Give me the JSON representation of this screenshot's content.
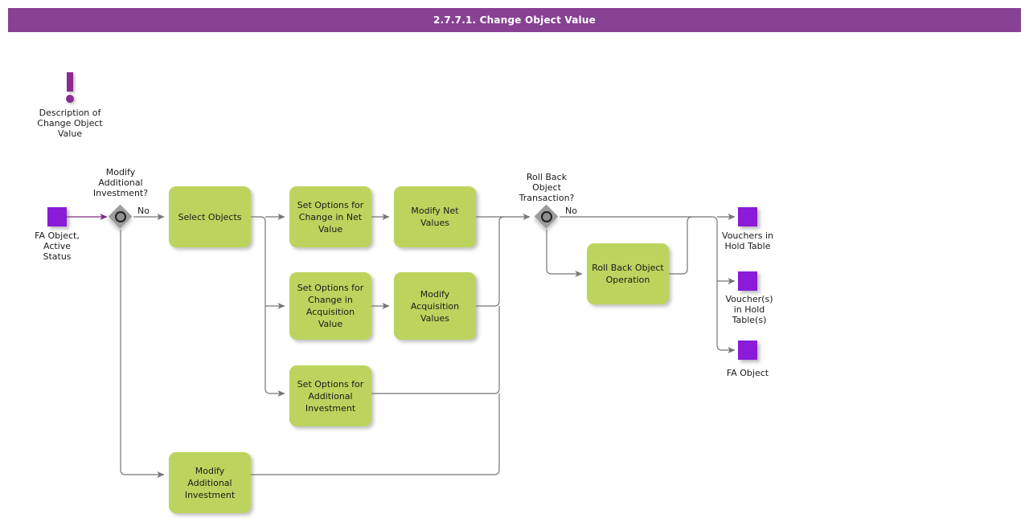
{
  "header": {
    "title": "2.7.7.1. Change Object Value",
    "bar_color": "#874293",
    "text_color": "#ffffff"
  },
  "palette": {
    "task_green": "#bcd45e",
    "data_purple": "#8a1bd9",
    "annotation_purple": "#8b2a8f",
    "gateway_gray": "#9c9c9c",
    "connector_gray": "#757575",
    "start_flow_purple": "#7b2a7e"
  },
  "annotation": {
    "icon": "exclamation-icon",
    "caption": "Description of\nChange Object\nValue"
  },
  "start_objects": [
    {
      "id": "fa-object-active-status",
      "icon": "data-object-icon",
      "caption": "FA Object,\nActive\nStatus"
    }
  ],
  "gateways": [
    {
      "id": "modify-additional-investment",
      "icon": "event-gateway-icon",
      "caption": "Modify\nAdditional\nInvestment?",
      "branch_label": "No"
    },
    {
      "id": "roll-back-object-transaction",
      "icon": "event-gateway-icon",
      "caption": "Roll Back\nObject\nTransaction?",
      "branch_label": "No"
    }
  ],
  "tasks": [
    {
      "id": "select-objects",
      "label": "Select Objects"
    },
    {
      "id": "set-options-change-net-value",
      "label": "Set Options for\nChange in Net\nValue"
    },
    {
      "id": "modify-net-values",
      "label": "Modify Net\nValues"
    },
    {
      "id": "set-options-change-acquisition-value",
      "label": "Set Options for\nChange in\nAcquisition\nValue"
    },
    {
      "id": "modify-acquisition-values",
      "label": "Modify\nAcquisition\nValues"
    },
    {
      "id": "set-options-additional-investment",
      "label": "Set Options for\nAdditional\nInvestment"
    },
    {
      "id": "modify-additional-investment",
      "label": "Modify\nAdditional\nInvestment"
    },
    {
      "id": "roll-back-object-operation",
      "label": "Roll Back Object\nOperation"
    }
  ],
  "end_objects": [
    {
      "id": "vouchers-in-hold-table",
      "icon": "data-object-icon",
      "caption": "Vouchers in\nHold Table"
    },
    {
      "id": "vouchers-in-hold-tables",
      "icon": "data-object-icon",
      "caption": "Voucher(s)\nin Hold\nTable(s)"
    },
    {
      "id": "fa-object",
      "icon": "data-object-icon",
      "caption": "FA Object"
    }
  ]
}
